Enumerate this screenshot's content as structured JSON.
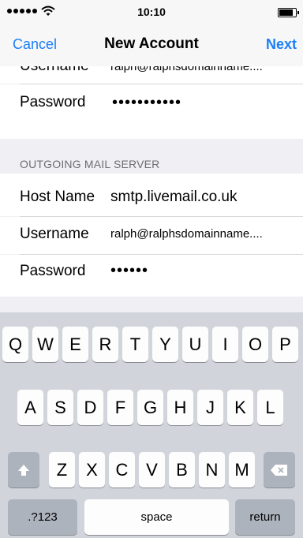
{
  "status_bar": {
    "time": "10:10",
    "battery_level": 0.85
  },
  "nav": {
    "cancel": "Cancel",
    "title": "New Account",
    "next": "Next"
  },
  "incoming": {
    "username_value": "ralph@ralphsdomainname....",
    "password_value": "•••••••••••",
    "username_label": "Username",
    "password_label": "Password"
  },
  "outgoing": {
    "header": "OUTGOING MAIL SERVER",
    "host_label": "Host Name",
    "host_value": "smtp.livemail.co.uk",
    "username_label": "Username",
    "username_value": "ralph@ralphsdomainname....",
    "password_label": "Password",
    "password_value": "••••••"
  },
  "keyboard": {
    "row1": [
      "Q",
      "W",
      "E",
      "R",
      "T",
      "Y",
      "U",
      "I",
      "O",
      "P"
    ],
    "row2": [
      "A",
      "S",
      "D",
      "F",
      "G",
      "H",
      "J",
      "K",
      "L"
    ],
    "row3": [
      "Z",
      "X",
      "C",
      "V",
      "B",
      "N",
      "M"
    ],
    "numbers": ".?123",
    "space": "space",
    "return": "return",
    "shift_icon": "shift-arrow",
    "delete_icon": "backspace"
  }
}
